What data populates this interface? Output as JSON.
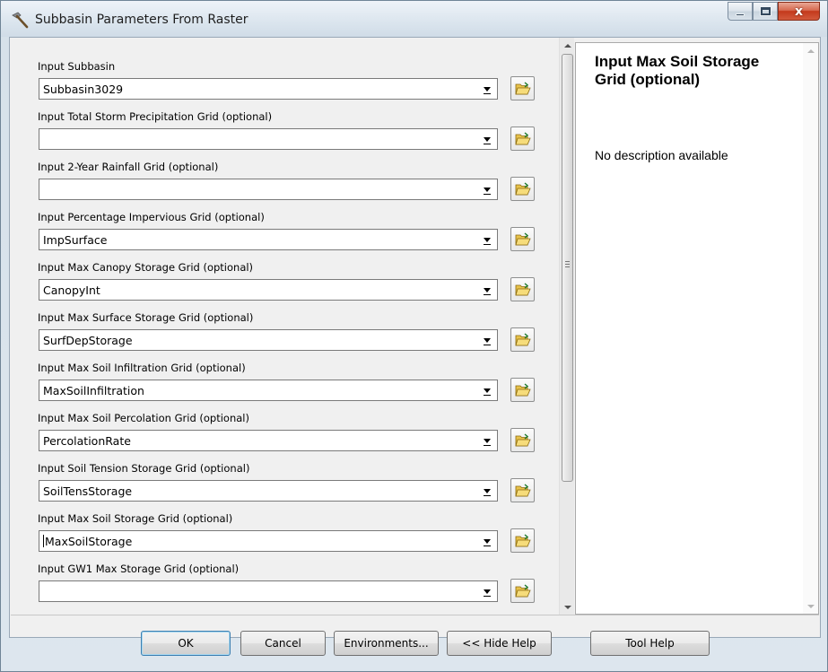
{
  "window": {
    "title": "Subbasin Parameters From Raster",
    "close_glyph": "x"
  },
  "parameters": [
    {
      "label": "Input Subbasin",
      "value": ""
    },
    {
      "label": "Input Total Storm Precipitation Grid (optional)",
      "value": ""
    },
    {
      "label": "Input 2-Year Rainfall Grid (optional)",
      "value": ""
    },
    {
      "label": "Input Percentage Impervious Grid (optional)",
      "value": "ImpSurface"
    },
    {
      "label": "Input Max Canopy Storage Grid (optional)",
      "value": "CanopyInt"
    },
    {
      "label": "Input Max Surface Storage Grid (optional)",
      "value": "SurfDepStorage"
    },
    {
      "label": "Input Max Soil Infiltration Grid (optional)",
      "value": "MaxSoilInfiltration"
    },
    {
      "label": "Input Max Soil Percolation Grid (optional)",
      "value": "PercolationRate"
    },
    {
      "label": "Input Soil Tension Storage Grid (optional)",
      "value": "SoilTensStorage"
    },
    {
      "label": "Input Max Soil Storage Grid (optional)",
      "value": "MaxSoilStorage"
    },
    {
      "label": "Input GW1 Max Storage Grid (optional)",
      "value": ""
    }
  ],
  "first_value": "Subbasin3029",
  "help": {
    "title": "Input Max Soil Storage Grid (optional)",
    "description": "No description available"
  },
  "buttons": {
    "ok": "OK",
    "cancel": "Cancel",
    "environments": "Environments...",
    "hide_help": "<< Hide Help",
    "tool_help": "Tool Help"
  },
  "icons": {
    "title": "hammer-icon",
    "browse": "open-folder-icon"
  }
}
